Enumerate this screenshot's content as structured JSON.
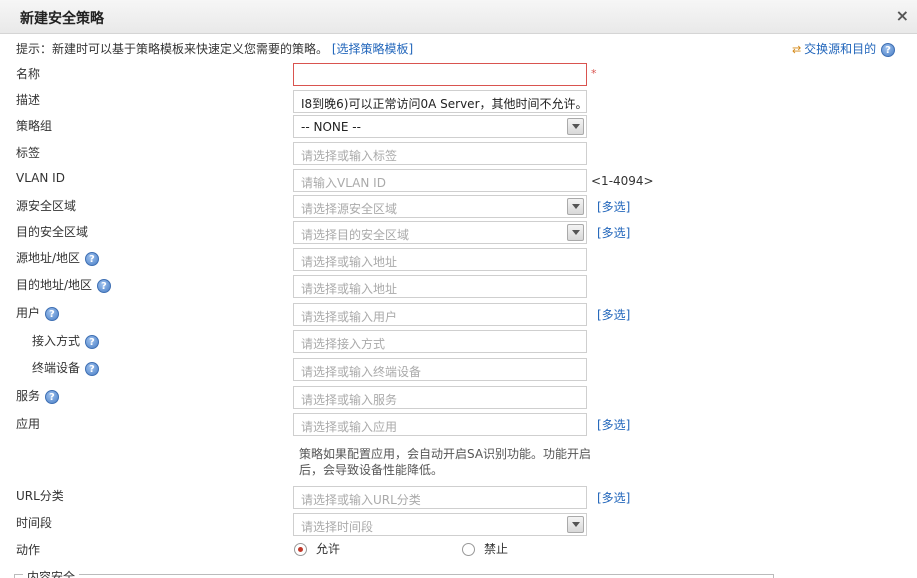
{
  "dialog": {
    "title": "新建安全策略"
  },
  "hint": {
    "text": "提示：新建时可以基于策略模板来快速定义您需要的策略。",
    "link": "[选择策略模板]"
  },
  "swap": {
    "label": "交换源和目的"
  },
  "form": {
    "name": {
      "label": "名称",
      "value": "",
      "required_mark": "*"
    },
    "description": {
      "label": "描述",
      "value": "I8到晚6)可以正常访问0A Server，其他时间不允许。|"
    },
    "policy_group": {
      "label": "策略组",
      "value": "-- NONE --"
    },
    "tag": {
      "label": "标签",
      "placeholder": "请选择或输入标签"
    },
    "vlan": {
      "label": "VLAN ID",
      "placeholder": "请输入VLAN ID",
      "range": "<1-4094>"
    },
    "src_zone": {
      "label": "源安全区域",
      "placeholder": "请选择源安全区域",
      "multi": "[多选]"
    },
    "dst_zone": {
      "label": "目的安全区域",
      "placeholder": "请选择目的安全区域",
      "multi": "[多选]"
    },
    "src_addr": {
      "label": "源地址/地区",
      "placeholder": "请选择或输入地址"
    },
    "dst_addr": {
      "label": "目的地址/地区",
      "placeholder": "请选择或输入地址"
    },
    "user": {
      "label": "用户",
      "placeholder": "请选择或输入用户",
      "multi": "[多选]"
    },
    "access": {
      "label": "接入方式",
      "placeholder": "请选择接入方式"
    },
    "terminal": {
      "label": "终端设备",
      "placeholder": "请选择或输入终端设备"
    },
    "service": {
      "label": "服务",
      "placeholder": "请选择或输入服务"
    },
    "application": {
      "label": "应用",
      "placeholder": "请选择或输入应用",
      "multi": "[多选]",
      "note": "策略如果配置应用，会自动开启SA识别功能。功能开启后，会导致设备性能降低。"
    },
    "url": {
      "label": "URL分类",
      "placeholder": "请选择或输入URL分类",
      "multi": "[多选]"
    },
    "time": {
      "label": "时间段",
      "placeholder": "请选择时间段"
    },
    "action": {
      "label": "动作",
      "allow": "允许",
      "deny": "禁止",
      "selected": "allow"
    }
  },
  "content_security": {
    "legend": "内容安全"
  },
  "colors": {
    "accent": "#2266bb",
    "required": "#d9534f",
    "radio_selected": "#c0392b"
  },
  "icons": {
    "help": "help-icon",
    "close": "close-icon",
    "swap": "swap-arrows-icon",
    "dropdown": "chevron-down-icon"
  }
}
